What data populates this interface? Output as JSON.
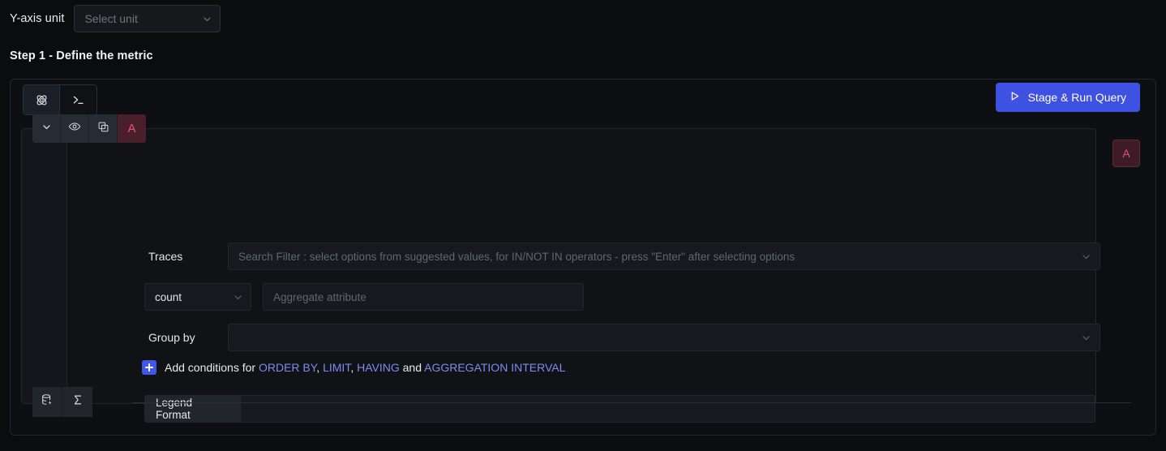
{
  "yaxis": {
    "label": "Y-axis unit",
    "select_placeholder": "Select unit",
    "chevron_icon": "chevron-down-icon"
  },
  "step": {
    "heading": "Step 1 - Define the metric"
  },
  "toolbar": {
    "tabs": [
      {
        "icon": "query-builder-atom-icon",
        "active": true
      },
      {
        "icon": "terminal-prompt-icon",
        "active": false
      }
    ],
    "run_button": {
      "label": "Stage & Run Query",
      "icon": "play-triangle-icon",
      "color": "#3f51e0"
    }
  },
  "query": {
    "letter": "A",
    "letter_color": "#e8526f",
    "header_actions": [
      {
        "name": "collapse",
        "icon": "chevron-down-icon"
      },
      {
        "name": "visibility",
        "icon": "eye-icon"
      },
      {
        "name": "duplicate",
        "icon": "copy-icon"
      }
    ],
    "footer_actions": [
      {
        "name": "data-source",
        "icon": "database-icon"
      },
      {
        "name": "formula",
        "icon": "sigma-icon"
      }
    ],
    "traces": {
      "label": "Traces",
      "placeholder": "Search Filter : select options from suggested values, for IN/NOT IN operators - press \"Enter\" after selecting options",
      "value": ""
    },
    "aggregate": {
      "function": "count",
      "attribute_placeholder": "Aggregate attribute",
      "attribute_value": ""
    },
    "group_by": {
      "label": "Group by",
      "placeholder": "",
      "value": ""
    },
    "conditions": {
      "plus_icon": "plus-icon",
      "prefix": "Add conditions for",
      "links": [
        "ORDER BY",
        "LIMIT",
        "HAVING",
        "AGGREGATION INTERVAL"
      ],
      "separator_1": ", ",
      "separator_2": ", ",
      "conjunction": " and ",
      "link_color": "#7b8df0"
    },
    "legend": {
      "label": "Legend Format",
      "value": ""
    }
  }
}
